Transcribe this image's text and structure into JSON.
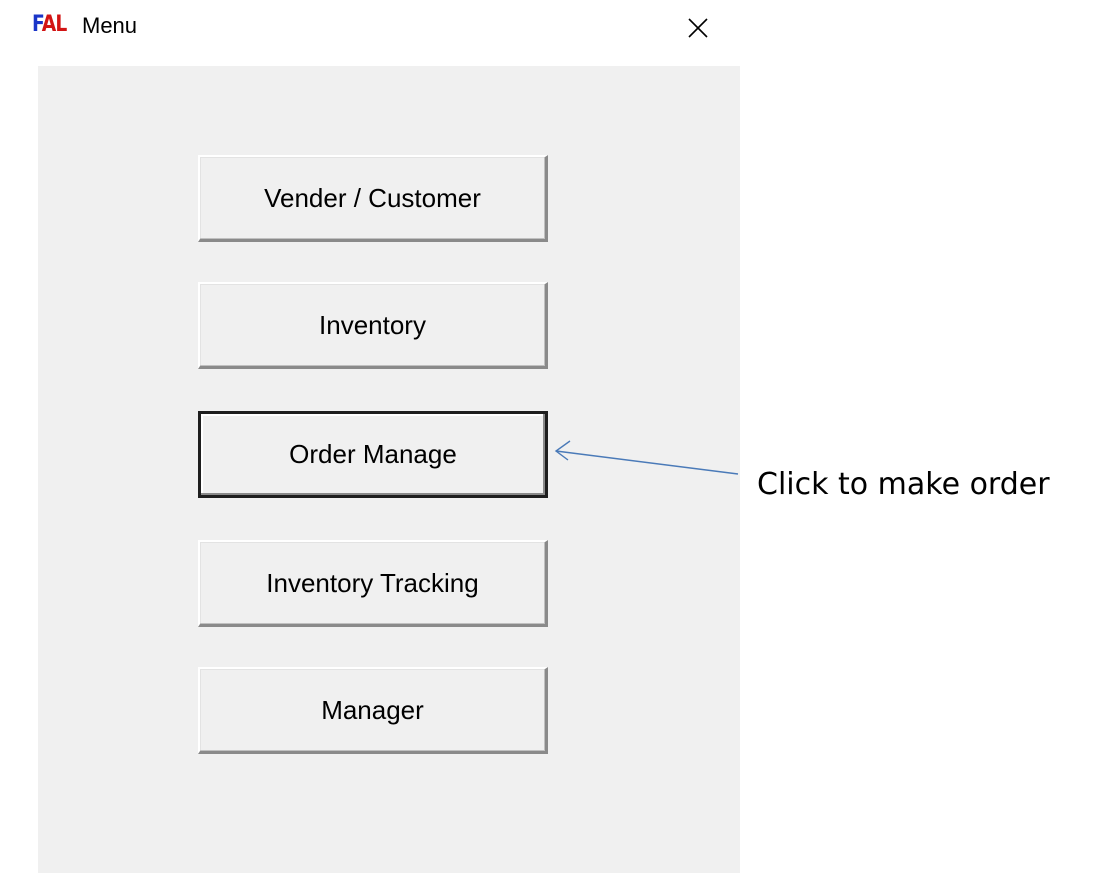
{
  "window": {
    "app_icon_text": [
      "F",
      "A",
      "L"
    ],
    "title": "Menu",
    "close_glyph": "×"
  },
  "menu": {
    "buttons": [
      {
        "label": "Vender / Customer"
      },
      {
        "label": "Inventory"
      },
      {
        "label": "Order Manage",
        "focused": true
      },
      {
        "label": "Inventory Tracking"
      },
      {
        "label": "Manager"
      }
    ]
  },
  "annotation": {
    "text": "Click to make order",
    "points_to": "Order Manage",
    "arrow_color": "#4a7ab8"
  },
  "colors": {
    "app_icon_blue": "#1a35c8",
    "app_icon_red": "#d21414",
    "client_background": "#f0f0f0"
  }
}
